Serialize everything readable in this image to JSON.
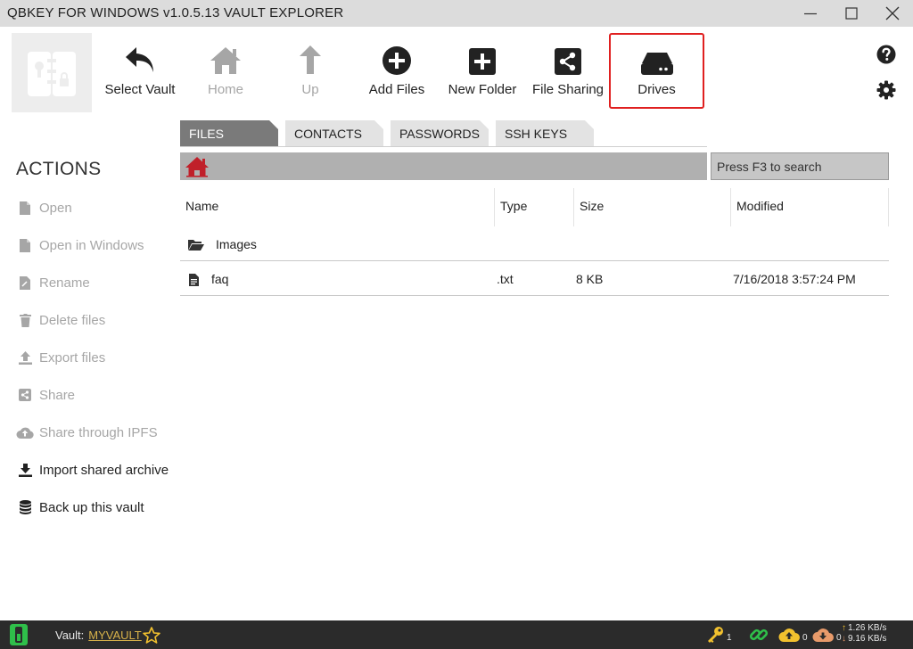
{
  "window": {
    "title": "QBKEY FOR WINDOWS v1.0.5.13  VAULT EXPLORER"
  },
  "toolbar": {
    "items": [
      {
        "label": "Select Vault",
        "icon": "undo-arrow-icon",
        "enabled": true
      },
      {
        "label": "Home",
        "icon": "home-icon",
        "enabled": false
      },
      {
        "label": "Up",
        "icon": "up-arrow-icon",
        "enabled": false
      },
      {
        "label": "Add Files",
        "icon": "plus-circle-icon",
        "enabled": true
      },
      {
        "label": "New Folder",
        "icon": "plus-square-icon",
        "enabled": true
      },
      {
        "label": "File Sharing",
        "icon": "share-icon",
        "enabled": true
      },
      {
        "label": "Drives",
        "icon": "hard-drive-icon",
        "enabled": true,
        "highlighted": true
      }
    ]
  },
  "tabs": [
    {
      "label": "FILES",
      "active": true
    },
    {
      "label": "CONTACTS",
      "active": false
    },
    {
      "label": "PASSWORDS",
      "active": false
    },
    {
      "label": "SSH KEYS",
      "active": false
    }
  ],
  "search": {
    "placeholder": "Press F3 to search"
  },
  "actions": {
    "title": "ACTIONS",
    "items": [
      {
        "label": "Open",
        "icon": "file-icon",
        "enabled": false
      },
      {
        "label": "Open in Windows",
        "icon": "file-icon",
        "enabled": false
      },
      {
        "label": "Rename",
        "icon": "file-edit-icon",
        "enabled": false
      },
      {
        "label": "Delete files",
        "icon": "trash-icon",
        "enabled": false
      },
      {
        "label": "Export files",
        "icon": "upload-icon",
        "enabled": false
      },
      {
        "label": "Share",
        "icon": "share-icon",
        "enabled": false
      },
      {
        "label": "Share through IPFS",
        "icon": "cloud-upload-icon",
        "enabled": false
      },
      {
        "label": "Import shared archive",
        "icon": "download-icon",
        "enabled": true
      },
      {
        "label": "Back up this vault",
        "icon": "database-icon",
        "enabled": true
      }
    ]
  },
  "files": {
    "columns": [
      "Name",
      "Type",
      "Size",
      "Modified"
    ],
    "rows": [
      {
        "name": "Images",
        "type": "",
        "size": "",
        "modified": "",
        "icon": "folder-open-icon"
      },
      {
        "name": "faq",
        "type": ".txt",
        "size": "8 KB",
        "modified": "7/16/2018 3:57:24 PM",
        "icon": "text-file-icon"
      }
    ]
  },
  "status": {
    "vault_label": "Vault:",
    "vault_name": "MYVAULT",
    "key_count": "1",
    "upload_count": "0",
    "download_count": "0",
    "upload_speed": "1.26 KB/s",
    "download_speed": "9.16 KB/s"
  },
  "colors": {
    "accent_red": "#e02020",
    "home_red": "#c0202a",
    "link_gold": "#d8b24a",
    "status_green": "#2fbf4a",
    "star_yellow": "#f2c12e",
    "cloud_orange": "#e89a6a"
  }
}
